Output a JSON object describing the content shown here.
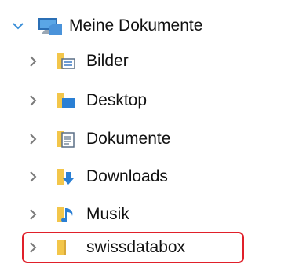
{
  "tree": {
    "root": {
      "label": "Meine Dokumente",
      "expanded": true,
      "icon": "computer-documents-icon"
    },
    "items": [
      {
        "label": "Bilder",
        "icon": "pictures-folder-icon"
      },
      {
        "label": "Desktop",
        "icon": "desktop-folder-icon"
      },
      {
        "label": "Dokumente",
        "icon": "documents-folder-icon"
      },
      {
        "label": "Downloads",
        "icon": "downloads-folder-icon"
      },
      {
        "label": "Musik",
        "icon": "music-folder-icon"
      },
      {
        "label": "swissdatabox",
        "icon": "folder-icon",
        "highlighted": true
      }
    ]
  },
  "colors": {
    "chevron": "#7a7a7a",
    "expanded_chevron": "#3a8fd8",
    "folder": "#f3c64a",
    "highlight_border": "#e0202a"
  }
}
